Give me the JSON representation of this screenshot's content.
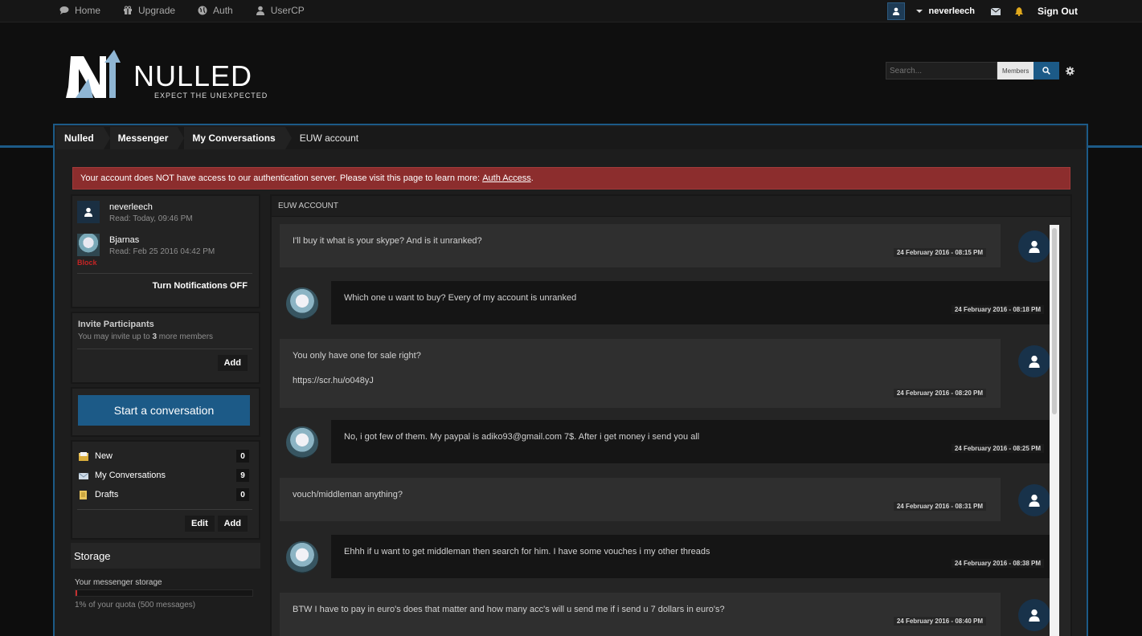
{
  "topnav": [
    {
      "label": "Home",
      "icon": "chat-bubble-icon"
    },
    {
      "label": "Upgrade",
      "icon": "gift-icon"
    },
    {
      "label": "Auth",
      "icon": "globe-icon"
    },
    {
      "label": "UserCP",
      "icon": "user-icon"
    }
  ],
  "topright": {
    "username": "neverleech",
    "signout": "Sign Out"
  },
  "logo": {
    "text": "NULLED",
    "tagline": "EXPECT THE UNEXPECTED"
  },
  "search": {
    "placeholder": "Search...",
    "scope": "Members"
  },
  "breadcrumbs": [
    "Nulled",
    "Messenger",
    "My Conversations",
    "EUW account"
  ],
  "alert": {
    "text": "Your account does NOT have access to our authentication server. Please visit this page to learn more: ",
    "link": "Auth Access",
    "end": "."
  },
  "participants": [
    {
      "name": "neverleech",
      "read": "Read: Today, 09:46 PM"
    },
    {
      "name": "Bjarnas",
      "read": "Read: Feb 25 2016 04:42 PM",
      "block": "Block"
    }
  ],
  "notifications": {
    "label": "Turn Notifications ",
    "state": "OFF"
  },
  "invite": {
    "title": "Invite Participants",
    "sub_pre": "You may invite up to ",
    "sub_num": "3",
    "sub_post": " more members",
    "add": "Add"
  },
  "start_button": "Start a conversation",
  "folders": [
    {
      "label": "New",
      "count": "0"
    },
    {
      "label": "My Conversations",
      "count": "9"
    },
    {
      "label": "Drafts",
      "count": "0"
    }
  ],
  "folder_actions": {
    "edit": "Edit",
    "add": "Add"
  },
  "storage": {
    "title": "Storage",
    "label": "Your messenger storage",
    "quota": "1% of your quota (500 messages)",
    "percent": 1
  },
  "conversation": {
    "title": "EUW account",
    "messages": [
      {
        "from": "me",
        "text": "I'll buy it what is your skype? And is it unranked?",
        "date": "24 February 2016 - 08:15 PM"
      },
      {
        "from": "them",
        "text": "Which one u want to buy? Every of my account is unranked",
        "date": "24 February 2016 - 08:18 PM"
      },
      {
        "from": "me",
        "text": "You only have one for sale right?",
        "text2": "https://scr.hu/o048yJ",
        "date": "24 February 2016 - 08:20 PM"
      },
      {
        "from": "them",
        "text": "No, i got few of them. My paypal is adiko93@gmail.com 7$. After i get money i send you all",
        "date": "24 February 2016 - 08:25 PM"
      },
      {
        "from": "me",
        "text": "vouch/middleman anything?",
        "date": "24 February 2016 - 08:31 PM"
      },
      {
        "from": "them",
        "text": "Ehhh if u want to get middleman then search for him. I have some vouches i my other threads",
        "date": "24 February 2016 - 08:38 PM"
      },
      {
        "from": "me",
        "text": "BTW I have to pay in euro's does that matter and how many acc's will u send me if i send u 7 dollars in euro's?",
        "date": "24 February 2016 - 08:40 PM"
      }
    ]
  }
}
